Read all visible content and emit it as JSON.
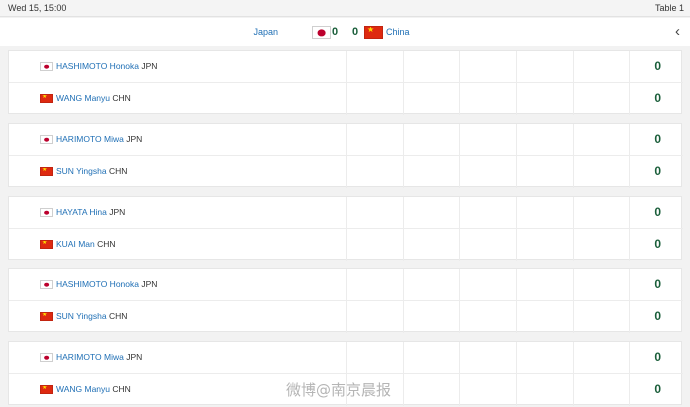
{
  "topbar": {
    "date": "Wed 15, 15:00",
    "table": "Table 1"
  },
  "header": {
    "home_team": "Japan",
    "away_team": "China",
    "home_score": "0",
    "away_score": "0",
    "back_icon": "chevron-left-icon"
  },
  "matches": [
    {
      "players": [
        {
          "name": "HASHIMOTO Honoka",
          "country": "JPN",
          "score": "0",
          "flag": "japan-flag-icon"
        },
        {
          "name": "WANG Manyu",
          "country": "CHN",
          "score": "0",
          "flag": "china-flag-icon"
        }
      ]
    },
    {
      "players": [
        {
          "name": "HARIMOTO Miwa",
          "country": "JPN",
          "score": "0",
          "flag": "japan-flag-icon"
        },
        {
          "name": "SUN Yingsha",
          "country": "CHN",
          "score": "0",
          "flag": "china-flag-icon"
        }
      ]
    },
    {
      "players": [
        {
          "name": "HAYATA Hina",
          "country": "JPN",
          "score": "0",
          "flag": "japan-flag-icon"
        },
        {
          "name": "KUAI Man",
          "country": "CHN",
          "score": "0",
          "flag": "china-flag-icon"
        }
      ]
    },
    {
      "players": [
        {
          "name": "HASHIMOTO Honoka",
          "country": "JPN",
          "score": "0",
          "flag": "japan-flag-icon"
        },
        {
          "name": "SUN Yingsha",
          "country": "CHN",
          "score": "0",
          "flag": "china-flag-icon"
        }
      ]
    },
    {
      "players": [
        {
          "name": "HARIMOTO Miwa",
          "country": "JPN",
          "score": "0",
          "flag": "japan-flag-icon"
        },
        {
          "name": "WANG Manyu",
          "country": "CHN",
          "score": "0",
          "flag": "china-flag-icon"
        }
      ]
    }
  ],
  "watermark": "微博@南京晨报",
  "colors": {
    "link": "#1f6fb5",
    "score": "#1a5e3a",
    "jp_red": "#bc002d",
    "cn_red": "#de2910",
    "cn_star": "#ffde00"
  }
}
